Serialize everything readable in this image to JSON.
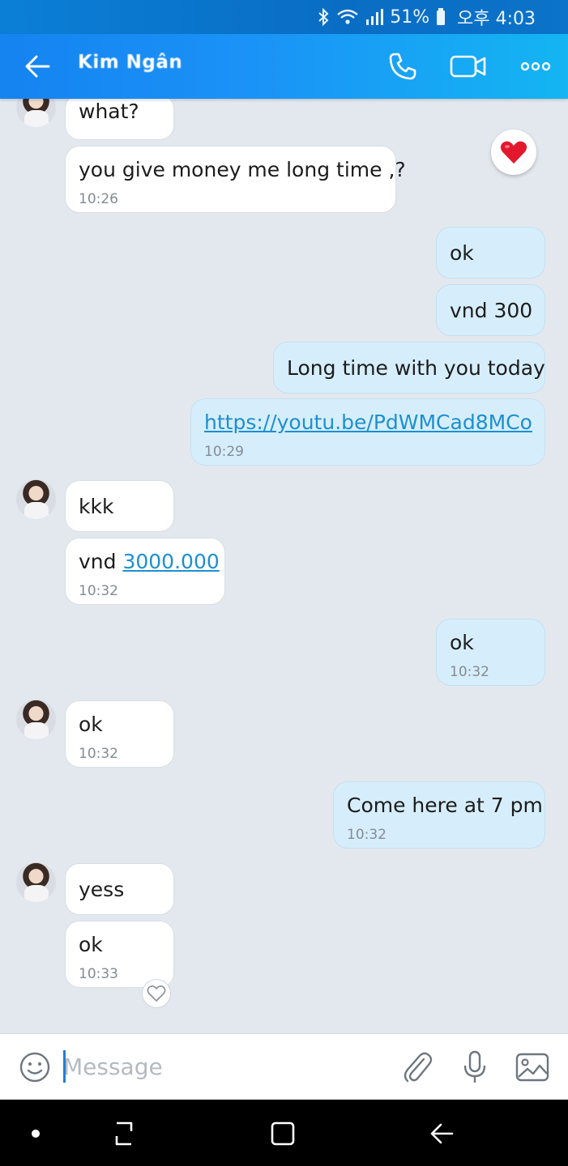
{
  "status_bar": {
    "battery": "51%",
    "time": "오후 4:03",
    "icons": [
      "bluetooth-icon",
      "wifi-icon",
      "signal-icon",
      "battery-icon"
    ]
  },
  "header": {
    "contact_name": "Kim Ngân",
    "icons": [
      "back-arrow-icon",
      "phone-icon",
      "video-icon",
      "more-icon"
    ]
  },
  "messages": [
    {
      "dir": "in",
      "text": "what?",
      "time": ""
    },
    {
      "dir": "in",
      "text": "you give money me long time ,?",
      "time": "10:26",
      "reaction": "heart"
    },
    {
      "dir": "out",
      "text": "ok",
      "time": ""
    },
    {
      "dir": "out",
      "text": "vnd 300",
      "time": ""
    },
    {
      "dir": "out",
      "text": "Long time with you today",
      "time": ""
    },
    {
      "dir": "out",
      "text": "https://youtu.be/PdWMCad8MCo",
      "time": "10:29",
      "link": true
    },
    {
      "dir": "in",
      "text": "kkk",
      "time": ""
    },
    {
      "dir": "in",
      "text_prefix": "vnd ",
      "link_text": "3000.000",
      "time": "10:32"
    },
    {
      "dir": "out",
      "text": "ok",
      "time": "10:32"
    },
    {
      "dir": "in",
      "text": "ok",
      "time": "10:32"
    },
    {
      "dir": "out",
      "text": "Come here at 7 pm",
      "time": "10:32"
    },
    {
      "dir": "in",
      "text": "yess",
      "time": ""
    },
    {
      "dir": "in",
      "text": "ok",
      "time": "10:33"
    }
  ],
  "composer": {
    "placeholder": "Message",
    "icons": [
      "emoji-icon",
      "attachment-icon",
      "microphone-icon",
      "image-icon"
    ]
  },
  "nav_bar": {
    "icons": [
      "dot-icon",
      "recents-icon",
      "home-icon",
      "back-icon"
    ]
  },
  "colors": {
    "header": "#1a93f7",
    "incoming_bubble": "#ffffff",
    "outgoing_bubble": "#d6eefc",
    "link": "#1d8fd0",
    "background": "#e3e8ef"
  }
}
